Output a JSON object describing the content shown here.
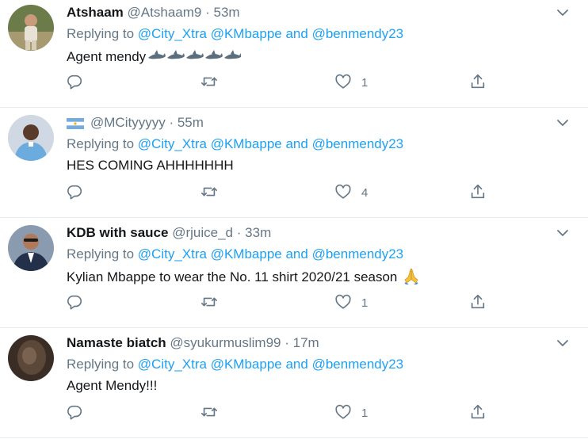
{
  "tweets": [
    {
      "name": "Atshaam",
      "handle": "@Atshaam9",
      "time": "53m",
      "replying_label": "Replying to",
      "mention1": "@City_Xtra",
      "mention2": "@KMbappe",
      "and_word": "and",
      "mention3": "@benmendy23",
      "text": "Agent mendy",
      "emoji": [
        "shark",
        "shark",
        "shark",
        "shark",
        "shark"
      ],
      "likes": "1",
      "avatar_bg": "#6b7b4a"
    },
    {
      "name": "",
      "handle": "@MCityyyyy",
      "time": "55m",
      "replying_label": "Replying to",
      "mention1": "@City_Xtra",
      "mention2": "@KMbappe",
      "and_word": "and",
      "mention3": "@benmendy23",
      "text": "HES COMING AHHHHHHH",
      "flag": "argentina-flag",
      "likes": "4",
      "avatar_bg": "#2e6fae"
    },
    {
      "name": "KDB with sauce",
      "handle": "@rjuice_d",
      "time": "33m",
      "replying_label": "Replying to",
      "mention1": "@City_Xtra",
      "mention2": "@KMbappe",
      "and_word": "and",
      "mention3": "@benmendy23",
      "text": "Kylian Mbappe to wear the No. 11 shirt 2020/21 season",
      "emoji": [
        "folded-hands"
      ],
      "likes": "1",
      "avatar_bg": "#3d4f6a"
    },
    {
      "name": "Namaste biatch",
      "handle": "@syukurmuslim99",
      "time": "17m",
      "replying_label": "Replying to",
      "mention1": "@City_Xtra",
      "mention2": "@KMbappe",
      "and_word": "and",
      "mention3": "@benmendy23",
      "text": "Agent Mendy!!!",
      "likes": "1",
      "avatar_bg": "#4a3a30"
    }
  ],
  "colors": {
    "link": "#1da1f2",
    "muted": "#657786",
    "text": "#14171a",
    "border": "#e6ecf0"
  },
  "icons": [
    "reply-icon",
    "retweet-icon",
    "like-icon",
    "share-icon",
    "chevron-down-icon"
  ]
}
